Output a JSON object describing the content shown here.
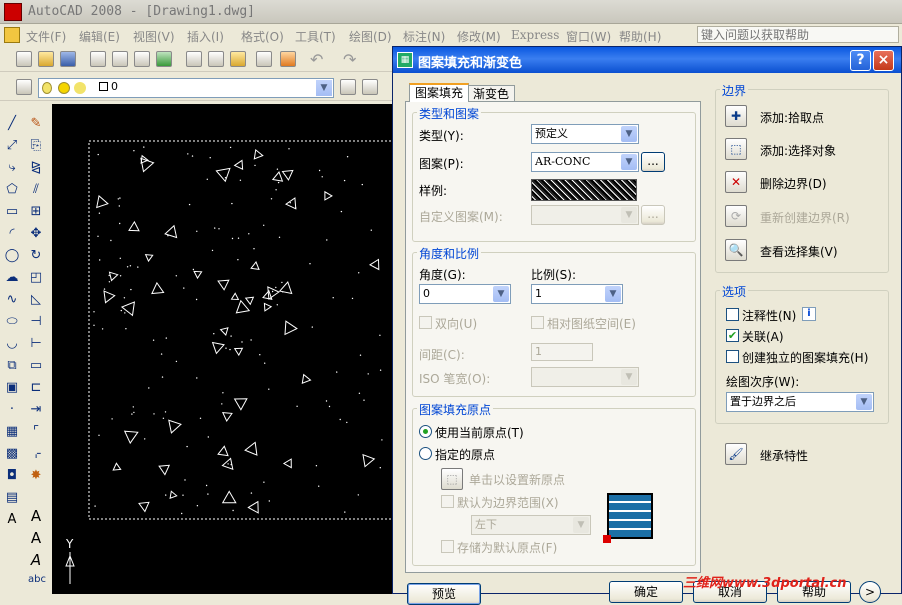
{
  "app": {
    "title": "AutoCAD 2008 - [Drawing1.dwg]"
  },
  "menu": [
    "文件(F)",
    "编辑(E)",
    "视图(V)",
    "插入(I)",
    "格式(O)",
    "工具(T)",
    "绘图(D)",
    "标注(N)",
    "修改(M)",
    "Express",
    "窗口(W)",
    "帮助(H)"
  ],
  "help_search": {
    "placeholder": "键入问题以获取帮助"
  },
  "layer_value": "0",
  "dialog": {
    "title": "图案填充和渐变色",
    "tabs": [
      "图案填充",
      "渐变色"
    ],
    "type_pattern": {
      "title": "类型和图案",
      "type_label": "类型(Y):",
      "type_value": "预定义",
      "pattern_label": "图案(P):",
      "pattern_value": "AR-CONC",
      "browse": "...",
      "sample_label": "样例:",
      "custom_label": "自定义图案(M):",
      "custom_browse": "..."
    },
    "angle_scale": {
      "title": "角度和比例",
      "angle_label": "角度(G):",
      "angle_value": "0",
      "scale_label": "比例(S):",
      "scale_value": "1",
      "double_label": "双向(U)",
      "relative_label": "相对图纸空间(E)",
      "spacing_label": "间距(C):",
      "spacing_value": "1",
      "iso_label": "ISO 笔宽(O):"
    },
    "origin": {
      "title": "图案填充原点",
      "use_current": "使用当前原点(T)",
      "specified": "指定的原点",
      "click_set": "单击以设置新原点",
      "default_extent": "默认为边界范围(X)",
      "position": "左下",
      "store_default": "存储为默认原点(F)"
    },
    "boundary": {
      "title": "边界",
      "add_pick": "添加:拾取点",
      "add_select": "添加:选择对象",
      "remove": "删除边界(D)",
      "recreate": "重新创建边界(R)",
      "view_set": "查看选择集(V)"
    },
    "options": {
      "title": "选项",
      "annotative": "注释性(N)",
      "info": "i",
      "associative": "关联(A)",
      "independent": "创建独立的图案填充(H)",
      "draw_order_label": "绘图次序(W):",
      "draw_order_value": "置于边界之后"
    },
    "inherit": "继承特性",
    "buttons": {
      "preview": "预览",
      "ok": "确定",
      "cancel": "取消",
      "help": "帮助",
      "more": ">"
    },
    "caption": {
      "help": "?",
      "close": "×"
    }
  },
  "watermark": "三维网www.3dportal.cn",
  "ucs": {
    "y": "Y"
  }
}
